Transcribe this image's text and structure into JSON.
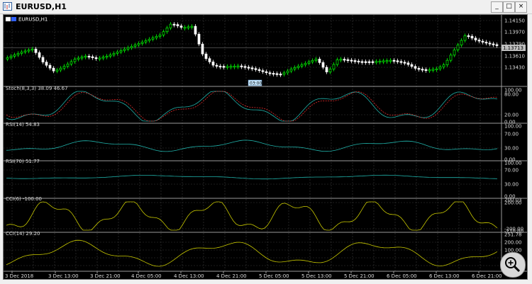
{
  "window": {
    "title": "EURUSD,H1",
    "buttons": [
      "_",
      "□",
      "×"
    ]
  },
  "chart": {
    "symbol_label": "EURUSD,H1",
    "current_price_tag": "1.13713",
    "time_marker": "03:00",
    "price_ticks": [
      "1.14150",
      "1.13970",
      "1.13790",
      "1.13610",
      "1.13430"
    ],
    "x_ticks": [
      "3 Dec 2018",
      "3 Dec 13:00",
      "3 Dec 21:00",
      "4 Dec 05:00",
      "4 Dec 13:00",
      "4 Dec 21:00",
      "5 Dec 05:00",
      "5 Dec 13:00",
      "5 Dec 21:00",
      "6 Dec 05:00",
      "6 Dec 13:00",
      "6 Dec 21:00"
    ],
    "zoom_icon": "magnifier-plus-icon"
  },
  "panes": [
    {
      "label": "Stoch(8,3,3) 38.09 46.67",
      "ticks": [
        "100.00",
        "80.00",
        "20.00",
        "0.00"
      ]
    },
    {
      "label": "RSI(14) 54.83",
      "ticks": [
        "100.00",
        "70.00",
        "30.00",
        "0.00"
      ]
    },
    {
      "label": "RSI(70) 51.77",
      "ticks": [
        "100.00",
        "70.00",
        "30.00",
        "0.00"
      ]
    },
    {
      "label": "CCI(6) -100.00",
      "ticks": [
        "200.03",
        "200.00",
        "-200.00",
        "-210.00"
      ]
    },
    {
      "label": "CCI(14) 29.20",
      "ticks": [
        "251.78",
        "200.00",
        "100.00",
        "0.00",
        "-100.00",
        "-200.00"
      ]
    }
  ],
  "colors": {
    "background": "#000000",
    "grid": "#3a3a3a",
    "bull": "#00ff00",
    "bear": "#ffffff",
    "stoch_main": "#20b2aa",
    "stoch_signal": "#ff3030",
    "rsi": "#20b2aa",
    "cci": "#c8c800"
  }
}
